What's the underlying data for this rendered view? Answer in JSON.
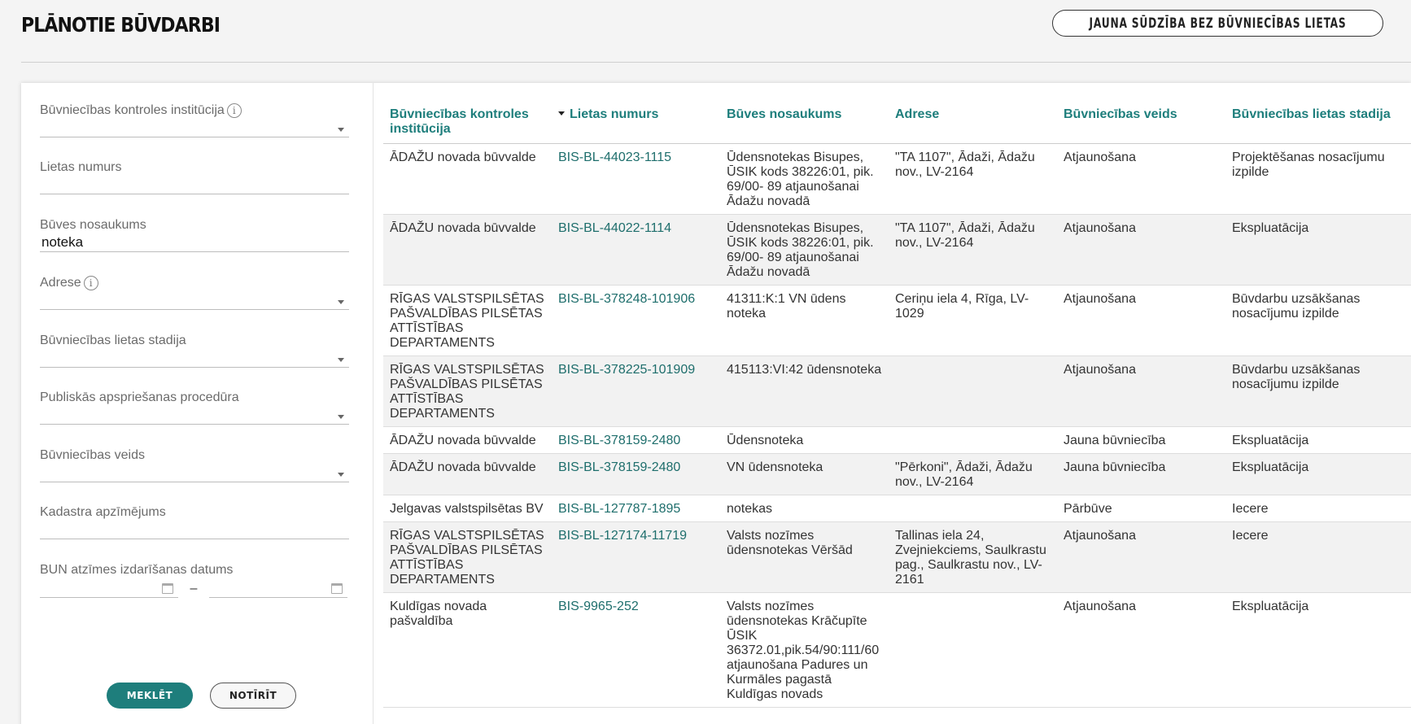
{
  "header": {
    "title": "PLĀNOTIE BŪVDARBI",
    "complaint_button": "JAUNA SŪDZĪBA BEZ BŪVNIECĪBAS LIETAS"
  },
  "filters": {
    "institution": {
      "label": "Būvniecības kontroles institūcija",
      "value": ""
    },
    "case_number": {
      "label": "Lietas numurs",
      "value": ""
    },
    "building_name": {
      "label": "Būves nosaukums",
      "value": "noteka"
    },
    "address": {
      "label": "Adrese",
      "value": ""
    },
    "case_stage": {
      "label": "Būvniecības lietas stadija",
      "value": ""
    },
    "public_discussion": {
      "label": "Publiskās apspriešanas procedūra",
      "value": ""
    },
    "construction_type": {
      "label": "Būvniecības veids",
      "value": ""
    },
    "cadastre": {
      "label": "Kadastra apzīmējums",
      "value": ""
    },
    "bun_date": {
      "label": "BUN atzīmes izdarīšanas datums",
      "separator": "–"
    },
    "search_button": "MEKLĒT",
    "clear_button": "NOTĪRĪT",
    "info_glyph": "i"
  },
  "table": {
    "columns": [
      "Būvniecības kontroles institūcija",
      "Lietas numurs",
      "Būves nosaukums",
      "Adrese",
      "Būvniecības veids",
      "Būvniecības lietas stadija"
    ],
    "rows": [
      {
        "institution": "ĀDAŽU novada būvvalde",
        "case": "BIS-BL-44023-1115",
        "name": "Ūdensnotekas Bisupes, ŪSIK kods 38226:01, pik. 69/00- 89 atjaunošanai Ādažu novadā",
        "address": "\"TA 1107\", Ādaži, Ādažu nov., LV-2164",
        "type": "Atjaunošana",
        "stage": "Projektēšanas nosacījumu izpilde"
      },
      {
        "institution": "ĀDAŽU novada būvvalde",
        "case": "BIS-BL-44022-1114",
        "name": "Ūdensnotekas Bisupes, ŪSIK kods 38226:01, pik. 69/00- 89 atjaunošanai Ādažu novadā",
        "address": "\"TA 1107\", Ādaži, Ādažu nov., LV-2164",
        "type": "Atjaunošana",
        "stage": "Ekspluatācija"
      },
      {
        "institution": "RĪGAS VALSTSPILSĒTAS PAŠVALDĪBAS PILSĒTAS ATTĪSTĪBAS DEPARTAMENTS",
        "case": "BIS-BL-378248-101906",
        "name": "41311:K:1 VN ūdens noteka",
        "address": "Ceriņu iela 4, Rīga, LV-1029",
        "type": "Atjaunošana",
        "stage": "Būvdarbu uzsākšanas nosacījumu izpilde"
      },
      {
        "institution": "RĪGAS VALSTSPILSĒTAS PAŠVALDĪBAS PILSĒTAS ATTĪSTĪBAS DEPARTAMENTS",
        "case": "BIS-BL-378225-101909",
        "name": "415113:VI:42 ūdensnoteka",
        "address": "",
        "type": "Atjaunošana",
        "stage": "Būvdarbu uzsākšanas nosacījumu izpilde"
      },
      {
        "institution": "ĀDAŽU novada būvvalde",
        "case": "BIS-BL-378159-2480",
        "name": "Ūdensnoteka",
        "address": "",
        "type": "Jauna būvniecība",
        "stage": "Ekspluatācija"
      },
      {
        "institution": "ĀDAŽU novada būvvalde",
        "case": "BIS-BL-378159-2480",
        "name": "VN ūdensnoteka",
        "address": "\"Pērkoni\", Ādaži, Ādažu nov., LV-2164",
        "type": "Jauna būvniecība",
        "stage": "Ekspluatācija"
      },
      {
        "institution": "Jelgavas valstspilsētas BV",
        "case": "BIS-BL-127787-1895",
        "name": "notekas",
        "address": "",
        "type": "Pārbūve",
        "stage": "Iecere"
      },
      {
        "institution": "RĪGAS VALSTSPILSĒTAS PAŠVALDĪBAS PILSĒTAS ATTĪSTĪBAS DEPARTAMENTS",
        "case": "BIS-BL-127174-11719",
        "name": "Valsts nozīmes ūdensnotekas Vēršād",
        "address": "Tallinas iela 24, Zvejniekciems, Saulkrastu pag., Saulkrastu nov., LV-2161",
        "type": "Atjaunošana",
        "stage": "Iecere"
      },
      {
        "institution": "Kuldīgas novada pašvaldība",
        "case": "BIS-9965-252",
        "name": "Valsts nozīmes ūdensnotekas Krāčupīte ŪSIK 36372.01,pik.54/90:111/60 atjaunošana Padures un Kurmāles pagastā Kuldīgas novads",
        "address": "",
        "type": "Atjaunošana",
        "stage": "Ekspluatācija"
      }
    ]
  }
}
